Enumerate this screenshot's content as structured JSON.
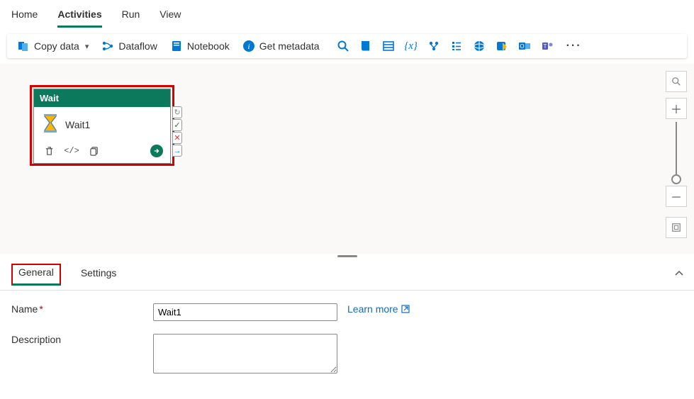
{
  "nav": {
    "items": [
      "Home",
      "Activities",
      "Run",
      "View"
    ],
    "active_index": 1
  },
  "toolbar": {
    "copy_data": "Copy data",
    "dataflow": "Dataflow",
    "notebook": "Notebook",
    "get_metadata": "Get metadata"
  },
  "activity": {
    "type_label": "Wait",
    "instance_name": "Wait1"
  },
  "panel": {
    "tabs": [
      "General",
      "Settings"
    ],
    "active_index": 0,
    "form": {
      "name_label": "Name",
      "name_value": "Wait1",
      "desc_label": "Description",
      "desc_value": "",
      "learn_more": "Learn more"
    }
  }
}
